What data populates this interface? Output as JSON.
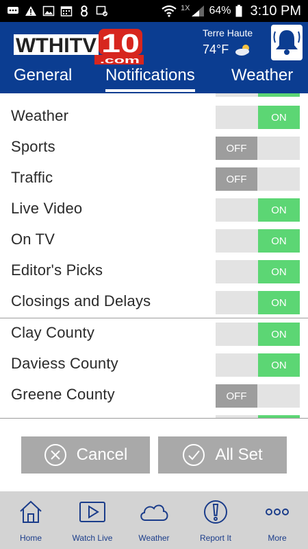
{
  "status_bar": {
    "signal_label": "1X",
    "battery": "64%",
    "time": "3:10 PM",
    "icons": [
      "chat-icon",
      "warning-icon",
      "image-icon",
      "calendar-icon",
      "app-8-icon",
      "photo-check-icon",
      "wifi-icon",
      "signal-icon",
      "battery-icon"
    ]
  },
  "header": {
    "logo_main": "WTHITV",
    "logo_number": "10",
    "logo_domain": ".com",
    "location": "Terre Haute",
    "temperature": "74°F",
    "weather_icon": "partly-cloudy-icon",
    "bell_icon": "bell-icon"
  },
  "tabs": [
    {
      "label": "General",
      "active": false
    },
    {
      "label": "Notifications",
      "active": true
    },
    {
      "label": "Weather",
      "active": false
    }
  ],
  "notifications": [
    {
      "label": "Weather",
      "state": "ON"
    },
    {
      "label": "Sports",
      "state": "OFF"
    },
    {
      "label": "Traffic",
      "state": "OFF"
    },
    {
      "label": "Live Video",
      "state": "ON"
    },
    {
      "label": "On TV",
      "state": "ON"
    },
    {
      "label": "Editor's Picks",
      "state": "ON"
    },
    {
      "label": "Closings and Delays",
      "state": "ON"
    }
  ],
  "counties": [
    {
      "label": "Clay County",
      "state": "ON"
    },
    {
      "label": "Daviess County",
      "state": "ON"
    },
    {
      "label": "Greene County",
      "state": "OFF"
    }
  ],
  "buttons": {
    "cancel_label": "Cancel",
    "allset_label": "All Set"
  },
  "bottom_nav": [
    {
      "label": "Home",
      "icon": "home-icon"
    },
    {
      "label": "Watch Live",
      "icon": "play-icon"
    },
    {
      "label": "Weather",
      "icon": "cloud-icon"
    },
    {
      "label": "Report It",
      "icon": "exclamation-icon"
    },
    {
      "label": "More",
      "icon": "more-icon"
    }
  ],
  "colors": {
    "header_blue": "#0b3d91",
    "toggle_on": "#5cd674",
    "toggle_off": "#9d9d9d",
    "button_gray": "#a9a9a9",
    "nav_bg": "#d3d3d3",
    "nav_text": "#1a3c8a"
  }
}
